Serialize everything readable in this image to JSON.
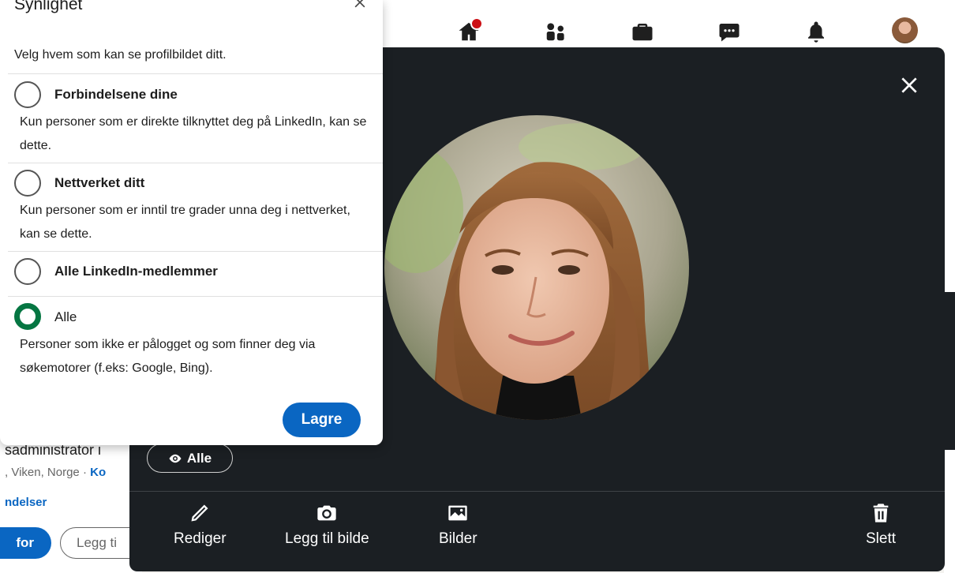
{
  "nav": {
    "icons": [
      "home-icon",
      "network-icon",
      "jobs-icon",
      "messaging-icon",
      "notifications-icon",
      "me-avatar"
    ]
  },
  "background": {
    "headline_fragment": "sadministrator i",
    "location_fragment": ", Viken, Norge · ",
    "location_link": "Ko",
    "connections_fragment": "ndelser",
    "primary_btn": "for",
    "secondary_btn": "Legg ti"
  },
  "visibility_popover": {
    "title": "Synlighet",
    "description": "Velg hvem som kan se profilbildet ditt.",
    "options": [
      {
        "label": "Forbindelsene dine",
        "help": "Kun personer som er direkte tilknyttet deg på LinkedIn, kan se dette.",
        "selected": false
      },
      {
        "label": "Nettverket ditt",
        "help": "Kun personer som er inntil tre grader unna deg i nettverket, kan se dette.",
        "selected": false
      },
      {
        "label": "Alle LinkedIn-medlemmer",
        "help": "",
        "selected": false
      },
      {
        "label": "Alle",
        "help": "Personer som ikke er pålogget og som finner deg via søkemotorer (f.eks: Google, Bing).",
        "selected": true
      }
    ],
    "save_label": "Lagre"
  },
  "photo_modal": {
    "visibility_value": "Alle",
    "actions": {
      "edit": "Rediger",
      "add_photo": "Legg til bilde",
      "photos": "Bilder",
      "delete": "Slett"
    }
  },
  "colors": {
    "accent_blue": "#0a66c2",
    "selected_green": "#057642",
    "modal_bg": "#1b1f23",
    "notification_red": "#cc1016"
  }
}
